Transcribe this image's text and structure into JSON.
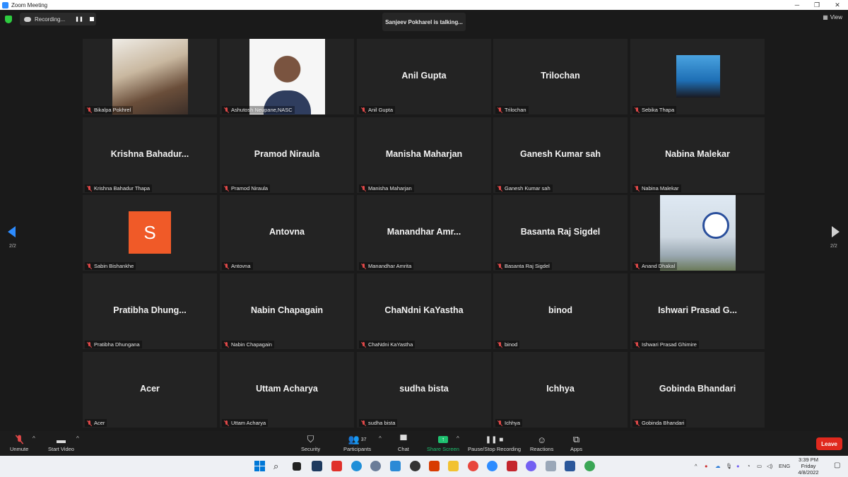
{
  "window": {
    "title": "Zoom Meeting"
  },
  "recording": {
    "label": "Recording..."
  },
  "talking_banner": "Sanjeev Pokharel is talking...",
  "view_label": "View",
  "page_indicator": "2/2",
  "tiles": [
    {
      "label": "Bikalpa Pokhrel",
      "big": ""
    },
    {
      "label": "Ashutosh Neupane,NASC",
      "big": ""
    },
    {
      "label": "Anil Gupta",
      "big": "Anil Gupta"
    },
    {
      "label": "Trilochan",
      "big": "Trilochan"
    },
    {
      "label": "Sebika Thapa",
      "big": ""
    },
    {
      "label": "Krishna Bahadur Thapa",
      "big": "Krishna  Bahadur..."
    },
    {
      "label": "Pramod Niraula",
      "big": "Pramod Niraula"
    },
    {
      "label": "Manisha Maharjan",
      "big": "Manisha Maharjan"
    },
    {
      "label": "Ganesh Kumar sah",
      "big": "Ganesh Kumar sah"
    },
    {
      "label": "Nabina Malekar",
      "big": "Nabina Malekar"
    },
    {
      "label": "Sabin Bishankhe",
      "big": ""
    },
    {
      "label": "Antovna",
      "big": "Antovna"
    },
    {
      "label": "Manandhar Amrita",
      "big": "Manandhar  Amr..."
    },
    {
      "label": "Basanta Raj Sigdel",
      "big": "Basanta Raj Sigdel"
    },
    {
      "label": "Anand Dhakal",
      "big": ""
    },
    {
      "label": "Pratibha Dhungana",
      "big": "Pratibha  Dhung..."
    },
    {
      "label": "Nabin Chapagain",
      "big": "Nabin Chapagain"
    },
    {
      "label": "ChaNdni KaYastha",
      "big": "ChaNdni KaYastha"
    },
    {
      "label": "binod",
      "big": "binod"
    },
    {
      "label": "Ishwari Prasad Ghimire",
      "big": "Ishwari Prasad G..."
    },
    {
      "label": "Acer",
      "big": "Acer"
    },
    {
      "label": "Uttam Acharya",
      "big": "Uttam Acharya"
    },
    {
      "label": "sudha bista",
      "big": "sudha bista"
    },
    {
      "label": "Ichhya",
      "big": "Ichhya"
    },
    {
      "label": "Gobinda Bhandari",
      "big": "Gobinda Bhandari"
    }
  ],
  "avatar_letter": "S",
  "toolbar": {
    "unmute": "Unmute",
    "start_video": "Start Video",
    "security": "Security",
    "participants": "Participants",
    "participants_count": "37",
    "chat": "Chat",
    "share_screen": "Share Screen",
    "pause_stop_recording": "Pause/Stop Recording",
    "reactions": "Reactions",
    "apps": "Apps",
    "leave": "Leave"
  },
  "taskbar": {
    "lang": "ENG",
    "time": "3:39 PM",
    "day": "Friday",
    "date": "4/8/2022"
  },
  "colors": {
    "accent": "#2d8cff",
    "leave": "#e0291e",
    "share": "#1ec270",
    "avatar": "#f05a28"
  }
}
